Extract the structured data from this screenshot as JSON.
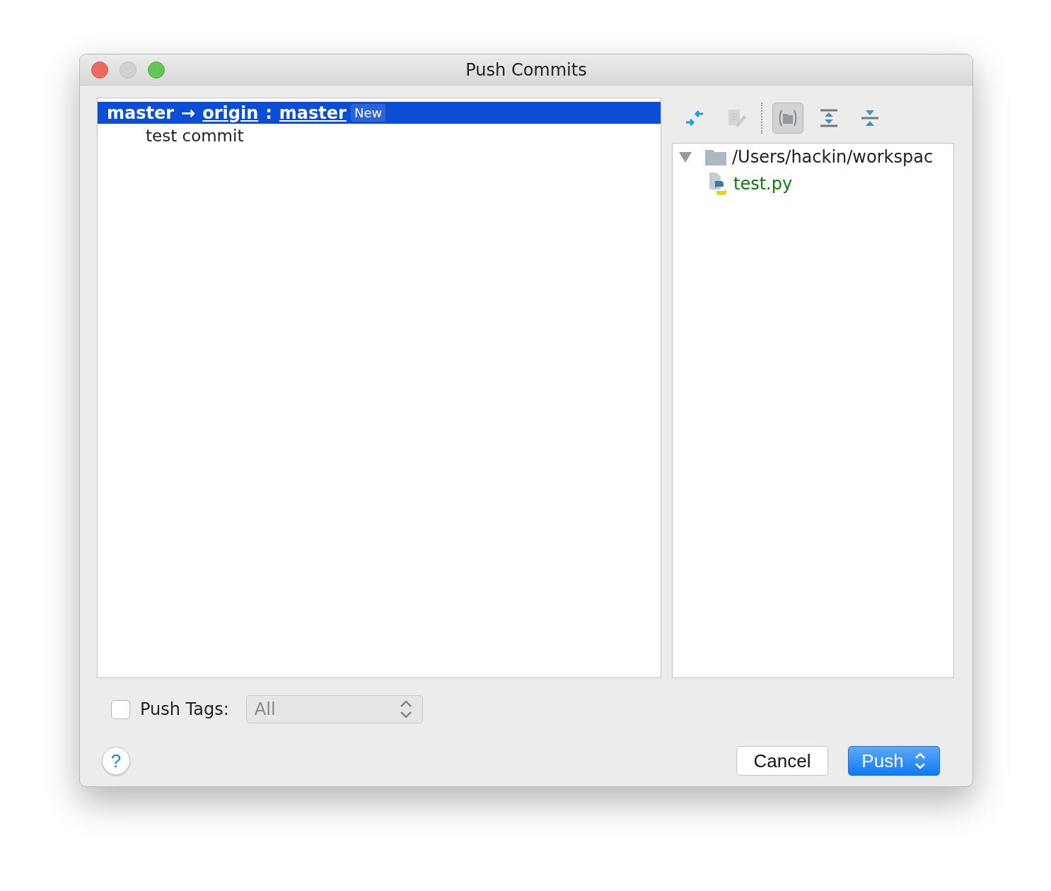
{
  "window": {
    "title": "Push Commits"
  },
  "commits_panel": {
    "branch": {
      "source": "master",
      "arrow": "→",
      "remote": "origin",
      "separator": ":",
      "target": "master",
      "badge": "New",
      "selected": true
    },
    "commits": [
      {
        "message": "test commit",
        "selected": false
      }
    ]
  },
  "toolbar": [
    {
      "kind": "diff",
      "on": false,
      "disabled": false
    },
    {
      "kind": "edit",
      "on": false,
      "disabled": true
    },
    {
      "kind": "group",
      "on": true,
      "disabled": false
    },
    {
      "kind": "expand",
      "on": false,
      "disabled": false
    },
    {
      "kind": "collapse",
      "on": false,
      "disabled": false
    }
  ],
  "file_tree": [
    {
      "label": "/Users/hackin/workspac",
      "kind": "folder",
      "expanded": true,
      "children": [
        {
          "label": "test.py",
          "kind": "python"
        }
      ]
    }
  ],
  "push_tags": {
    "label": "Push Tags:",
    "checked": false,
    "value": "All",
    "disabled": true
  },
  "help_button": {
    "label": "?"
  },
  "buttons": [
    {
      "label": "Cancel",
      "default": false
    },
    {
      "label": "Push",
      "default": true
    }
  ]
}
